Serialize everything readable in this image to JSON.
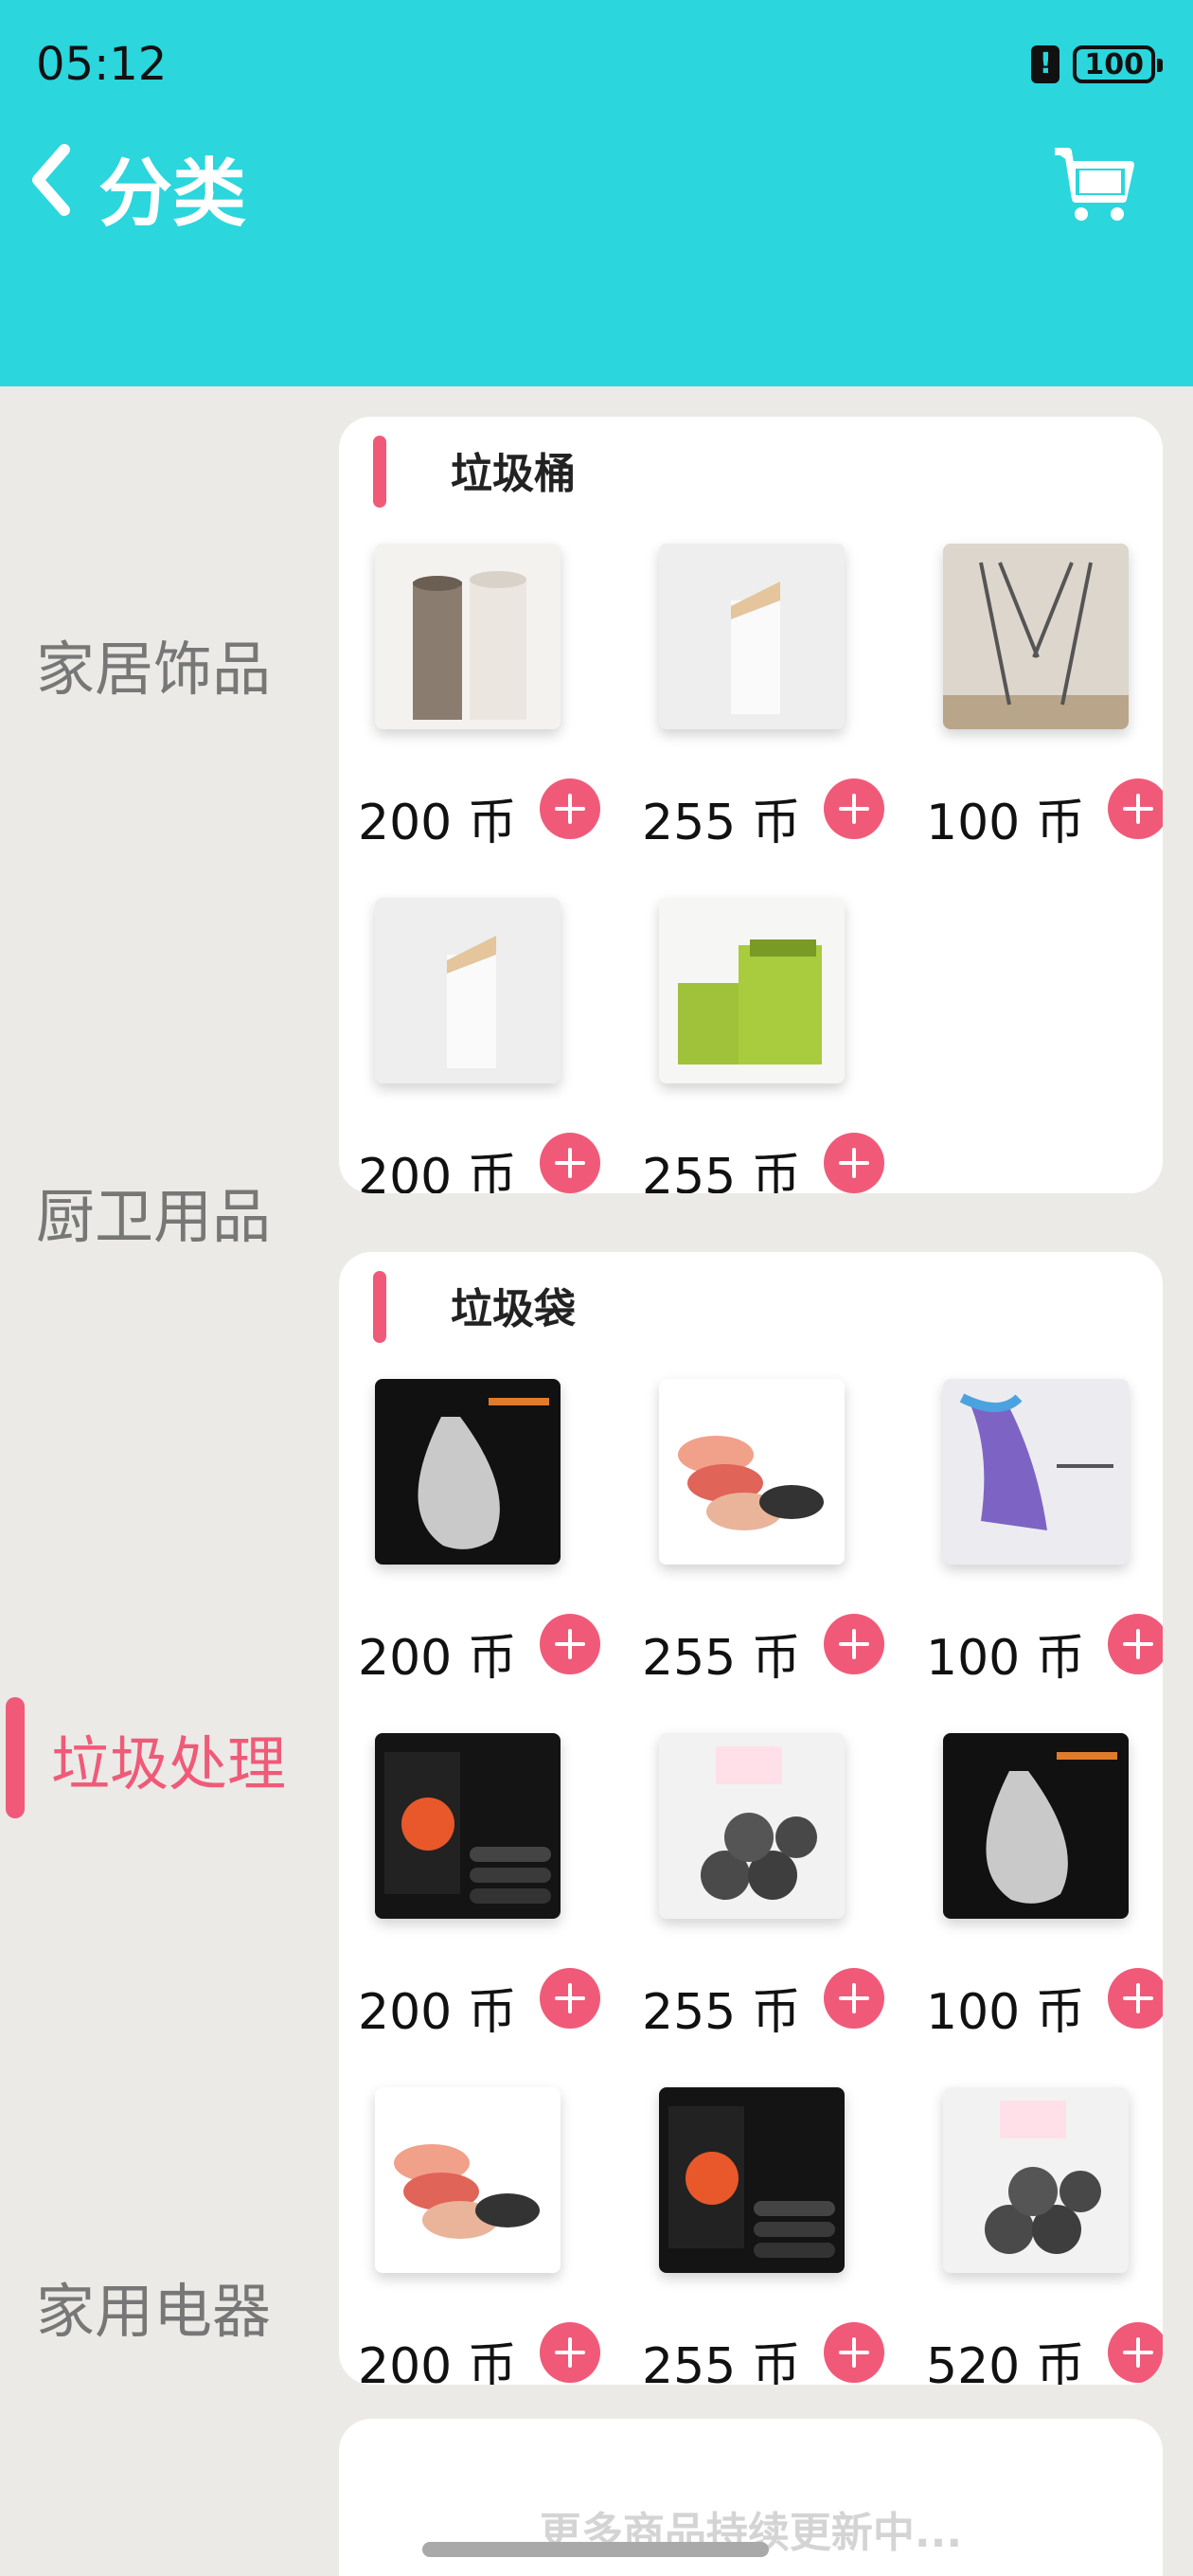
{
  "status": {
    "time": "05:12",
    "battery": "100"
  },
  "header": {
    "title": "分类",
    "back_icon": "chevron-left-icon",
    "cart_icon": "cart-icon"
  },
  "sidebar": {
    "items": [
      {
        "label": "家居饰品",
        "active": false
      },
      {
        "label": "厨卫用品",
        "active": false
      },
      {
        "label": "垃圾处理",
        "active": true
      },
      {
        "label": "家用电器",
        "active": false
      }
    ]
  },
  "sections": [
    {
      "title": "垃圾桶",
      "items": [
        {
          "price": "200 币",
          "image": "brown and white cylinder bins"
        },
        {
          "price": "255 币",
          "image": "white slanted bin"
        },
        {
          "price": "100 币",
          "image": "wire bag frame"
        },
        {
          "price": "200 币",
          "image": "white slanted bin"
        },
        {
          "price": "255 币",
          "image": "green square bins"
        }
      ]
    },
    {
      "title": "垃圾袋",
      "items": [
        {
          "price": "200 币",
          "image": "clear drawstring bag on black"
        },
        {
          "price": "255 币",
          "image": "colored bag rolls"
        },
        {
          "price": "100 币",
          "image": "purple drawstring bag"
        },
        {
          "price": "200 币",
          "image": "black box with mascot"
        },
        {
          "price": "255 币",
          "image": "grey bag rolls"
        },
        {
          "price": "100 币",
          "image": "clear drawstring bag on black"
        },
        {
          "price": "200 币",
          "image": "colored bag rolls"
        },
        {
          "price": "255 币",
          "image": "black box with mascot"
        },
        {
          "price": "520 币",
          "image": "grey bag rolls"
        }
      ]
    }
  ],
  "footer": {
    "more_text": "更多商品持续更新中..."
  },
  "colors": {
    "header": "#2bd6dd",
    "accent": "#f05a78",
    "background": "#ebeae6"
  }
}
